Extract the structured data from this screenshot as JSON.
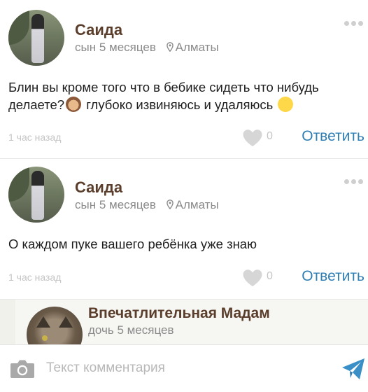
{
  "comments": [
    {
      "author": "Саида",
      "child": "сын 5 месяцев",
      "city": "Алматы",
      "text_part1": "Блин вы кроме того что в бебике сидеть что нибудь делаете?",
      "text_part2": " глубоко извиняюсь и удаляюсь ",
      "time": "1 час назад",
      "likes": "0",
      "reply_label": "Ответить"
    },
    {
      "author": "Саида",
      "child": "сын 5 месяцев",
      "city": "Алматы",
      "text": "О каждом пуке вашего ребёнка уже знаю",
      "time": "1 час назад",
      "likes": "0",
      "reply_label": "Ответить"
    }
  ],
  "reply": {
    "author": "Впечатлительная Мадам",
    "child": "дочь 5 месяцев"
  },
  "input": {
    "placeholder": "Текст комментария"
  },
  "colors": {
    "author": "#5a3e2b",
    "link": "#2f7fb5",
    "muted": "#c4c4c4",
    "meta": "#8a8a8a"
  },
  "icons": [
    "more-dots-icon",
    "location-pin-icon",
    "heart-icon",
    "camera-icon",
    "send-icon",
    "monkey-emoji-icon",
    "blush-emoji-icon"
  ]
}
